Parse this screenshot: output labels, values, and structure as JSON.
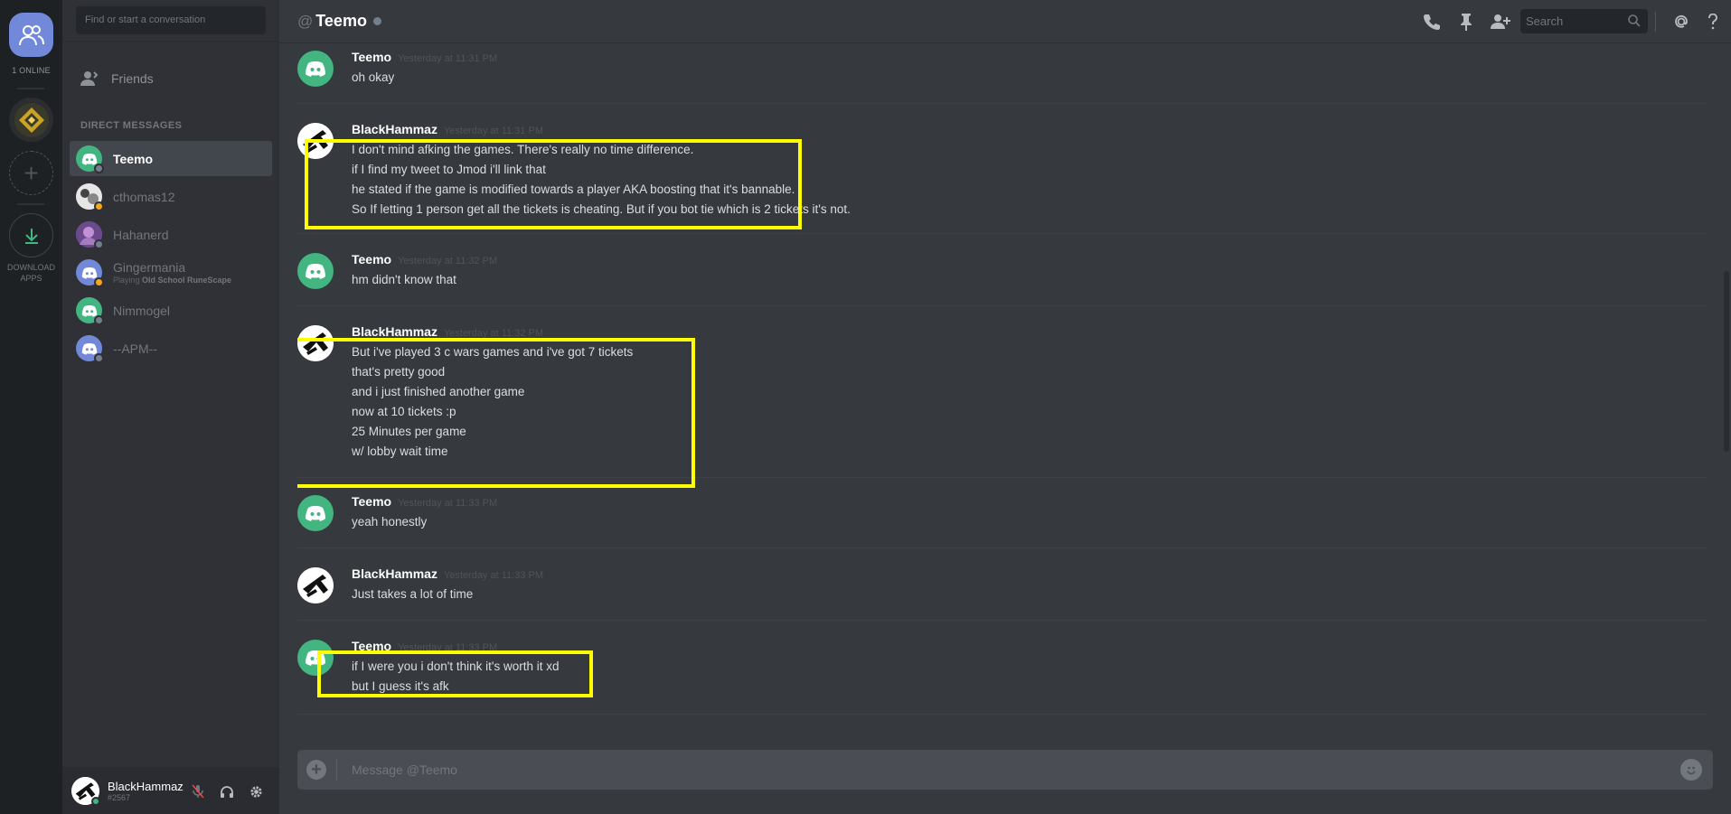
{
  "rail": {
    "online_label": "1 ONLINE",
    "download_label_1": "DOWNLOAD",
    "download_label_2": "APPS"
  },
  "sidebar": {
    "search_placeholder": "Find or start a conversation",
    "friends_label": "Friends",
    "dm_heading": "DIRECT MESSAGES",
    "items": [
      {
        "name": "Teemo",
        "status_color": "#747f8d",
        "avatar": "discord-logo",
        "avatar_color": "#43b581"
      },
      {
        "name": "cthomas12",
        "status_color": "#faa61a",
        "avatar": "photo-avatar",
        "avatar_color": "#6b6f76"
      },
      {
        "name": "Hahanerd",
        "status_color": "#747f8d",
        "avatar": "photo-avatar",
        "avatar_color": "#7d5a9e"
      },
      {
        "name": "Gingermania",
        "status_color": "#faa61a",
        "avatar": "discord-logo",
        "avatar_color": "#7289da",
        "activity_prefix": "Playing",
        "activity_game": "Old School RuneScape"
      },
      {
        "name": "Nimmogel",
        "status_color": "#747f8d",
        "avatar": "discord-logo",
        "avatar_color": "#43b581"
      },
      {
        "name": "--APM--",
        "status_color": "#747f8d",
        "avatar": "discord-logo",
        "avatar_color": "#7289da"
      }
    ]
  },
  "user": {
    "name": "BlackHammaz",
    "tag": "#2567",
    "status_color": "#43b581"
  },
  "header": {
    "at_symbol": "@",
    "title": "Teemo",
    "search_placeholder": "Search"
  },
  "messages": [
    {
      "author": "Teemo",
      "timestamp": "Yesterday at 11:31 PM",
      "avatar": "discord-logo",
      "lines": [
        "oh okay"
      ]
    },
    {
      "author": "BlackHammaz",
      "timestamp": "Yesterday at 11:31 PM",
      "avatar": "hammer-avatar",
      "lines": [
        "I don't mind afking the games. There's really no time difference.",
        "if I find my tweet to Jmod i'll link that",
        "he stated if the game is modified towards a player AKA boosting that it's bannable.",
        "So If  letting 1 person get all the tickets is cheating. But if you bot tie which is 2 tickets it's not."
      ]
    },
    {
      "author": "Teemo",
      "timestamp": "Yesterday at 11:32 PM",
      "avatar": "discord-logo",
      "lines": [
        "hm didn't know that"
      ]
    },
    {
      "author": "BlackHammaz",
      "timestamp": "Yesterday at 11:32 PM",
      "avatar": "hammer-avatar",
      "lines": [
        "But i've played 3 c wars games and i've got 7 tickets",
        "that's pretty good",
        "and i just finished another game",
        "now at 10 tickets :p",
        "25 Minutes per game",
        "w/ lobby wait time"
      ]
    },
    {
      "author": "Teemo",
      "timestamp": "Yesterday at 11:33 PM",
      "avatar": "discord-logo",
      "lines": [
        "yeah honestly"
      ]
    },
    {
      "author": "BlackHammaz",
      "timestamp": "Yesterday at 11:33 PM",
      "avatar": "hammer-avatar",
      "lines": [
        "Just takes a lot of time"
      ]
    },
    {
      "author": "Teemo",
      "timestamp": "Yesterday at 11:33 PM",
      "avatar": "discord-logo",
      "lines": [
        "if I were you i don't think it's worth it xd",
        "but I guess it's afk"
      ]
    }
  ],
  "composer": {
    "placeholder": "Message @Teemo"
  },
  "colors": {
    "highlight": "#ffff00",
    "blurple": "#7289da",
    "green": "#43b581"
  }
}
